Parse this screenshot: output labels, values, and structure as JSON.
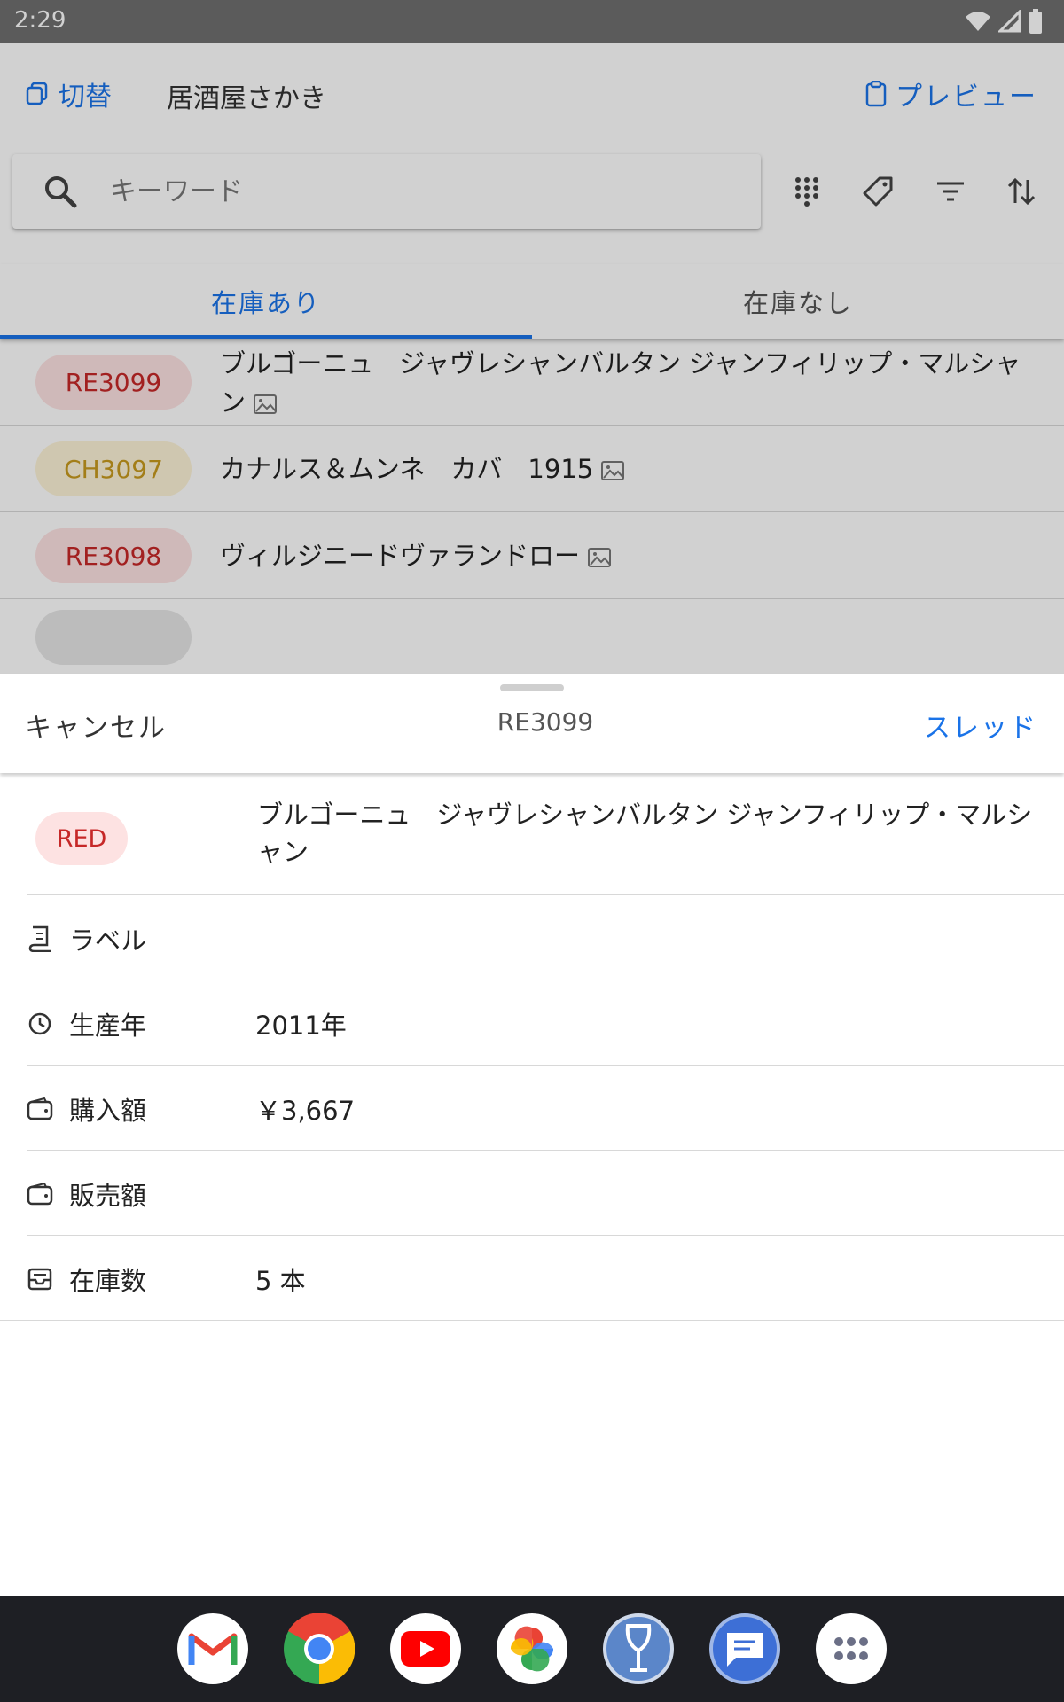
{
  "status_bar": {
    "time": "2:29"
  },
  "header": {
    "switch_label": "切替",
    "shop_name": "居酒屋さかき",
    "preview_label": "プレビュー"
  },
  "search": {
    "placeholder": "キーワード"
  },
  "tabs": [
    {
      "label": "在庫あり",
      "active": true
    },
    {
      "label": "在庫なし",
      "active": false
    }
  ],
  "list": [
    {
      "code": "RE3099",
      "name": "ブルゴーニュ　ジャヴレシャンバルタン ジャンフィリップ・マルシャン",
      "tag_color": "#c62828"
    },
    {
      "code": "CH3097",
      "name": "カナルス＆ムンネ　カバ　1915",
      "tag_color": "#c79a1e"
    },
    {
      "code": "RE3098",
      "name": "ヴィルジニードヴァランドロー",
      "tag_color": "#c62828"
    }
  ],
  "sheet": {
    "cancel_label": "キャンセル",
    "title": "RE3099",
    "thread_label": "スレッド",
    "color_tag": "RED",
    "name": "ブルゴーニュ　ジャヴレシャンバルタン ジャンフィリップ・マルシャン",
    "fields": [
      {
        "icon": "label-icon",
        "label": "ラベル",
        "value": ""
      },
      {
        "icon": "clock-icon",
        "label": "生産年",
        "value": "2011年"
      },
      {
        "icon": "wallet-icon",
        "label": "購入額",
        "value": "￥3,667"
      },
      {
        "icon": "wallet-icon",
        "label": "販売額",
        "value": ""
      },
      {
        "icon": "inbox-icon",
        "label": "在庫数",
        "value": "5 本"
      }
    ]
  },
  "dock": {
    "apps": [
      "gmail-icon",
      "chrome-icon",
      "youtube-icon",
      "photos-icon",
      "wine-app-icon",
      "messages-icon",
      "app-drawer-icon"
    ]
  },
  "colors": {
    "accent": "#1a73e8",
    "red_tag": "#c62828",
    "yellow_tag": "#c79a1e"
  }
}
